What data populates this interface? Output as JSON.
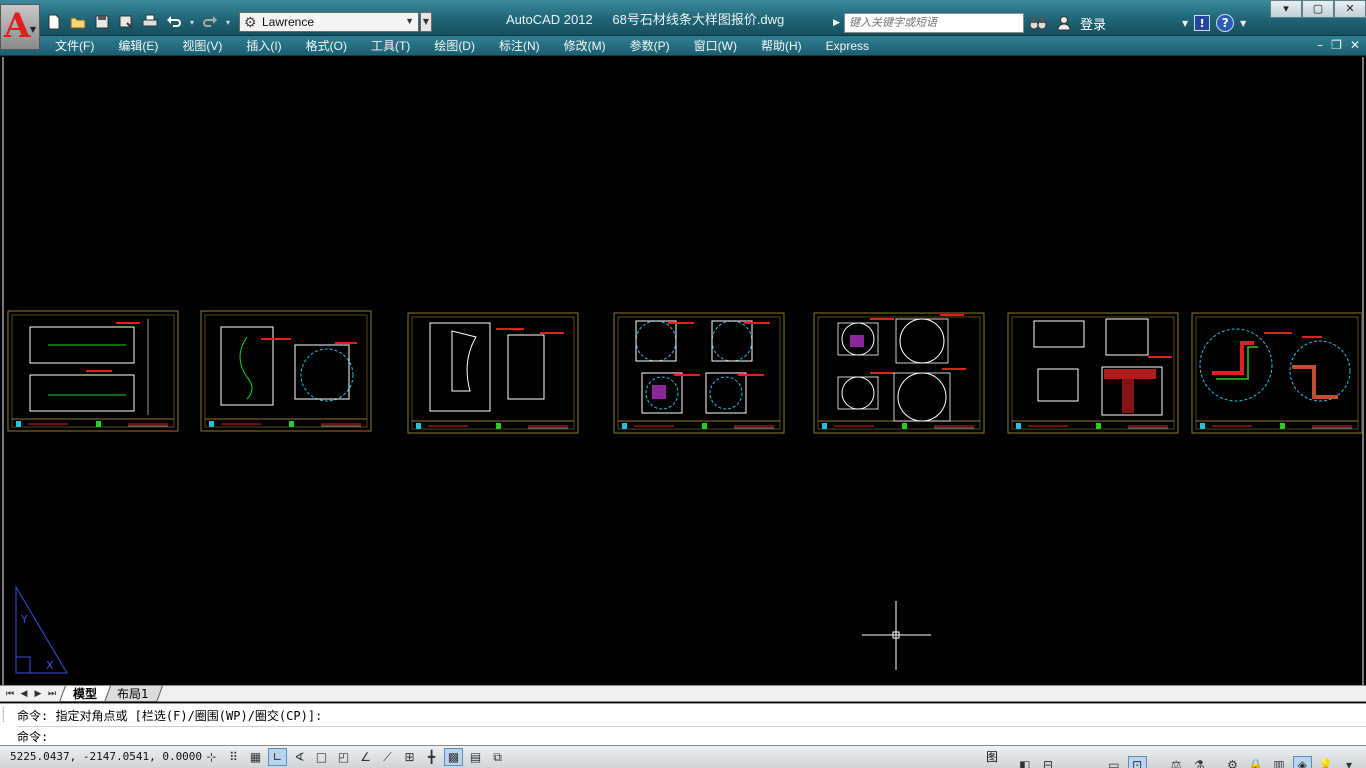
{
  "app": {
    "name": "AutoCAD 2012",
    "file": "68号石材线条大样图报价.dwg",
    "logo_letter": "A"
  },
  "quick_access": [
    {
      "name": "new-icon",
      "glyph": "🗋"
    },
    {
      "name": "open-icon",
      "glyph": "📂"
    },
    {
      "name": "save-icon",
      "glyph": "💾"
    },
    {
      "name": "save-as-icon",
      "glyph": "🖫"
    },
    {
      "name": "print-icon",
      "glyph": "🖶"
    },
    {
      "name": "undo-icon",
      "glyph": "↶"
    },
    {
      "name": "redo-icon",
      "glyph": "↷"
    }
  ],
  "workspace": {
    "value": "Lawrence"
  },
  "search": {
    "placeholder": "键入关键字或短语"
  },
  "login": {
    "label": "登录"
  },
  "help": {
    "exchange_glyph": "!",
    "help_glyph": "?"
  },
  "window_controls": {
    "minimize": "▾",
    "restore": "▢",
    "close": "✕"
  },
  "menu": [
    "文件(F)",
    "编辑(E)",
    "视图(V)",
    "插入(I)",
    "格式(O)",
    "工具(T)",
    "绘图(D)",
    "标注(N)",
    "修改(M)",
    "参数(P)",
    "窗口(W)",
    "帮助(H)",
    "Express"
  ],
  "doc_controls": {
    "minimize": "–",
    "restore": "❐",
    "close": "✕"
  },
  "tabs": [
    {
      "label": "模型",
      "active": true
    },
    {
      "label": "布局1",
      "active": false
    }
  ],
  "command": {
    "history": "命令: 指定对角点或 [栏选(F)/圈围(WP)/圈交(CP)]:",
    "prompt": "命令:"
  },
  "status": {
    "coordinates": "5225.0437, -2147.0541, 0.0000",
    "paper_label": "图纸"
  },
  "colors": {
    "canvas_bg": "#000000",
    "frame_border": "#8a7a2a",
    "drawing_white": "#ffffff",
    "annotation_red": "#e02020",
    "accent_green": "#20d020",
    "accent_cyan": "#20c0e0"
  }
}
